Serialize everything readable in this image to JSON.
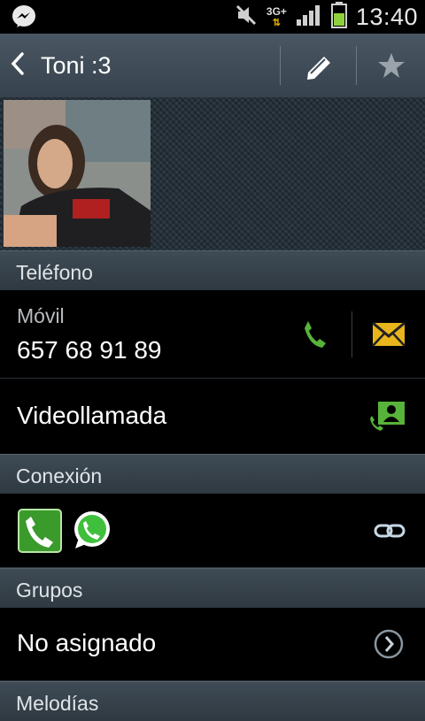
{
  "status_bar": {
    "time": "13:40",
    "network": "3G+",
    "icons": [
      "messenger-icon",
      "mute-icon",
      "network-3g-icon",
      "signal-icon",
      "battery-icon"
    ]
  },
  "action_bar": {
    "back_glyph": "‹",
    "title": "Toni :3",
    "actions": [
      "edit-icon",
      "favorite-star-icon"
    ]
  },
  "contact": {
    "photo": "contact-photo"
  },
  "sections": {
    "phone": "Teléfono",
    "connection": "Conexión",
    "groups": "Grupos",
    "ringtones": "Melodías"
  },
  "phone_entry": {
    "type": "Móvil",
    "number": "657 68 91 89"
  },
  "video_call": {
    "label": "Videollamada"
  },
  "groups_entry": {
    "value": "No asignado"
  },
  "colors": {
    "accent_green": "#58b33a",
    "message_yellow": "#e8b51d",
    "section_bg": "#36424c",
    "actionbar_bg": "#404d58"
  }
}
